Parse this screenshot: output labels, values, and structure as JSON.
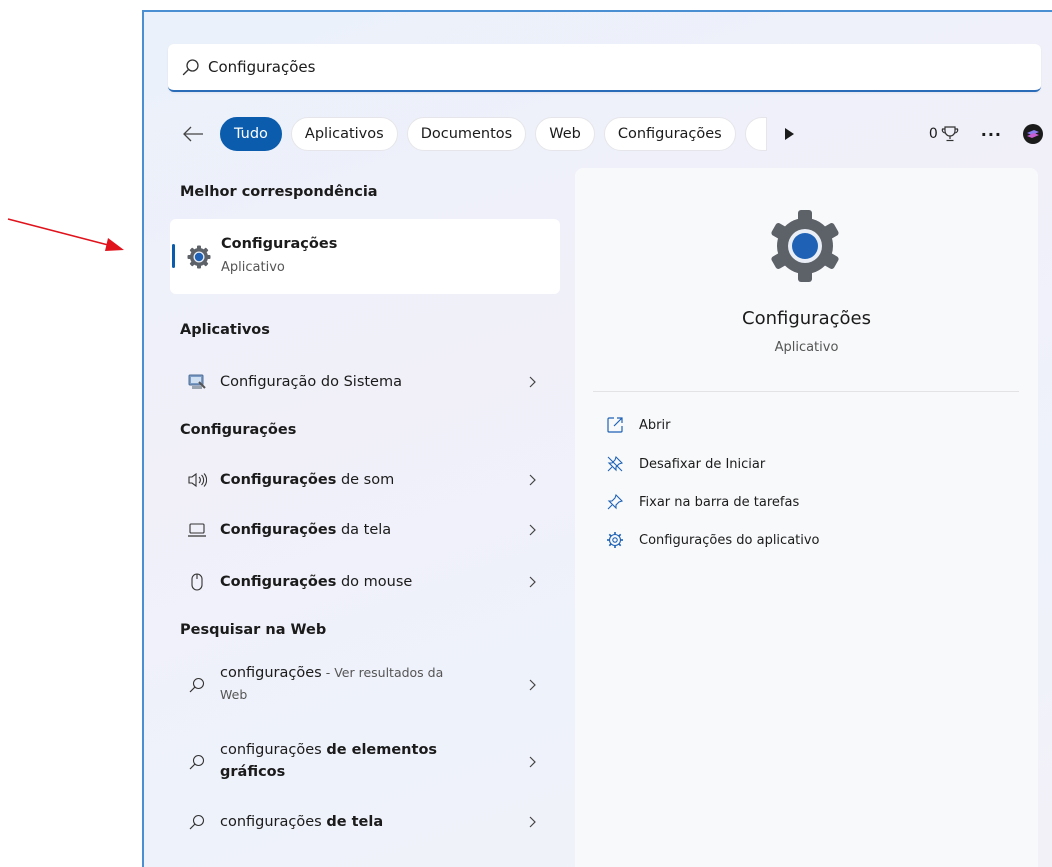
{
  "search": {
    "value": "Configurações"
  },
  "filters": {
    "items": [
      "Tudo",
      "Aplicativos",
      "Documentos",
      "Web",
      "Configurações"
    ],
    "active": "Tudo",
    "points": "0"
  },
  "left": {
    "best_match_header": "Melhor correspondência",
    "best_match": {
      "title": "Configurações",
      "subtitle": "Aplicativo"
    },
    "apps_header": "Aplicativos",
    "apps": [
      {
        "label": "Configuração do Sistema"
      }
    ],
    "settings_header": "Configurações",
    "settings": [
      {
        "bold": "Configurações",
        "rest": " de som"
      },
      {
        "bold": "Configurações",
        "rest": " da tela"
      },
      {
        "bold": "Configurações",
        "rest": " do mouse"
      }
    ],
    "web_header": "Pesquisar na Web",
    "web": [
      {
        "plain": "configurações",
        "suffix": " - Ver resultados da",
        "line2": "Web"
      },
      {
        "plain": "configurações ",
        "bold": "de elementos",
        "line2": "gráficos"
      },
      {
        "plain": "configurações ",
        "bold": "de tela"
      }
    ]
  },
  "detail": {
    "title": "Configurações",
    "kind": "Aplicativo",
    "actions": [
      {
        "label": "Abrir",
        "icon": "open-external-icon"
      },
      {
        "label": "Desafixar de Iniciar",
        "icon": "unpin-icon"
      },
      {
        "label": "Fixar na barra de tarefas",
        "icon": "pin-icon"
      },
      {
        "label": "Configurações do aplicativo",
        "icon": "gear-outline-icon"
      }
    ]
  },
  "colors": {
    "accent": "#0b5cad",
    "arrow": "#e0121b"
  }
}
